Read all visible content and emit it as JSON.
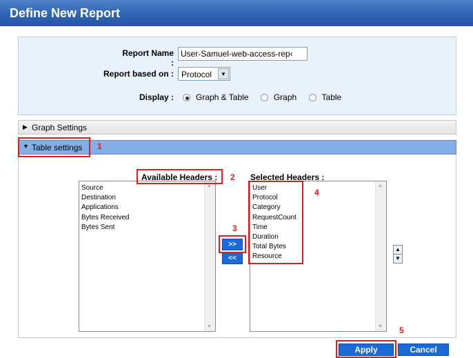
{
  "window": {
    "title": "Define New Report"
  },
  "form": {
    "report_name_label": "Report Name :",
    "report_name_value": "User-Samuel-web-access-rep‹",
    "based_on_label": "Report based on :",
    "based_on_value": "Protocol",
    "display_label": "Display :",
    "display_options": [
      {
        "label": "Graph & Table",
        "selected": true
      },
      {
        "label": "Graph",
        "selected": false
      },
      {
        "label": "Table",
        "selected": false
      }
    ]
  },
  "sections": {
    "graph_settings": {
      "label": "Graph Settings",
      "expanded": false
    },
    "table_settings": {
      "label": "Table settings",
      "expanded": true
    }
  },
  "available": {
    "header": "Available Headers :",
    "items": [
      "Source",
      "Destination",
      "Applications",
      "Bytes Received",
      "Bytes Sent"
    ]
  },
  "selected": {
    "header": "Selected Headers :",
    "items": [
      "User",
      "Protocol",
      "Category",
      "RequestCount",
      "Time",
      "Duration",
      "Total Bytes",
      "Resource"
    ]
  },
  "move": {
    "add_label": ">>",
    "remove_label": "<<"
  },
  "order": {
    "up_icon": "arrow-up-icon",
    "down_icon": "arrow-down-icon"
  },
  "actions": {
    "apply_label": "Apply",
    "cancel_label": "Cancel"
  },
  "callouts": [
    "1",
    "2",
    "3",
    "4",
    "5"
  ],
  "colors": {
    "accent": "#1a6bd8",
    "callout": "#e21c1c",
    "title_bar": "#2f64b4",
    "section_active": "#84aee6"
  }
}
